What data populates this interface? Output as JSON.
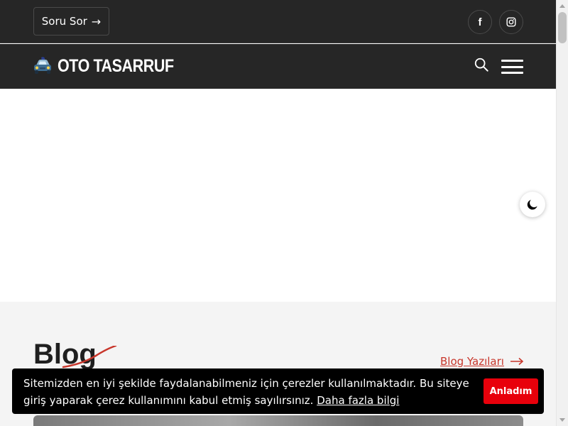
{
  "topbar": {
    "ask_label": "Soru Sor",
    "ask_arrow": "→",
    "social": [
      {
        "name": "facebook",
        "glyph": "f"
      },
      {
        "name": "instagram"
      }
    ]
  },
  "navbar": {
    "logo_text": "OTO TASARRUF"
  },
  "blog": {
    "title": "Blog",
    "link_label": "Blog Yazıları",
    "accent_color": "#c8362b"
  },
  "cookie": {
    "message": "Sitemizden en iyi şekilde faydalanabilmeniz için çerezler kullanılmaktadır. Bu siteye giriş yaparak çerez kullanımını kabul etmiş sayılırsınız.",
    "more_link": "Daha fazla bilgi",
    "accept_label": "Anladım",
    "accept_color": "#e8000b"
  },
  "icons": {
    "search": "search-icon",
    "menu": "hamburger-menu-icon",
    "dark_mode": "moon-icon",
    "facebook": "facebook-icon",
    "instagram": "instagram-icon"
  }
}
